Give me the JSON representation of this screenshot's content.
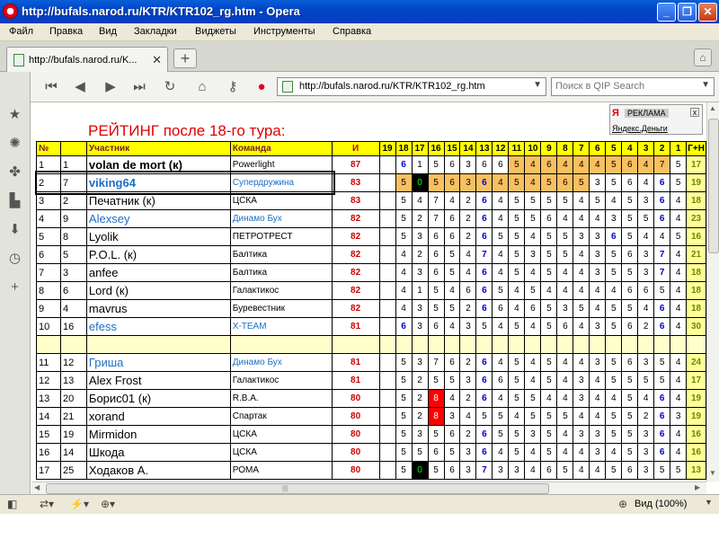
{
  "window": {
    "title": "http://bufals.narod.ru/KTR/KTR102_rg.htm - Opera"
  },
  "menu": [
    "Файл",
    "Правка",
    "Вид",
    "Закладки",
    "Виджеты",
    "Инструменты",
    "Справка"
  ],
  "tab": {
    "label": "http://bufals.narod.ru/K..."
  },
  "address": {
    "url": "http://bufals.narod.ru/KTR/KTR102_rg.htm"
  },
  "search": {
    "placeholder": "Поиск в QIP Search"
  },
  "ad": {
    "label": "РЕКЛАМА",
    "link": "Яндекс.Деньги"
  },
  "page": {
    "title": "РЕЙТИНГ после 18-го тура:",
    "headers": {
      "num": "№",
      "player": "Участник",
      "team": "Команда",
      "points": "И",
      "tours": [
        "19",
        "18",
        "17",
        "16",
        "15",
        "14",
        "13",
        "12",
        "11",
        "10",
        "9",
        "8",
        "7",
        "6",
        "5",
        "4",
        "3",
        "2",
        "1"
      ],
      "gp": "Г+Н"
    },
    "rows": [
      {
        "pos": "1",
        "id": "1",
        "name": "volan de mort (к)",
        "team": "Powerlight",
        "pts": "87",
        "gp": "17",
        "scores": [
          "",
          "6",
          "1",
          "5",
          "6",
          "3",
          "6",
          "6",
          "5",
          "4",
          "6",
          "4",
          "4",
          "4",
          "5",
          "6",
          "4",
          "7",
          "5"
        ]
      },
      {
        "pos": "2",
        "id": "7",
        "name": "viking64",
        "team": "Супердружина",
        "pts": "83",
        "gp": "19",
        "scores": [
          "",
          "5",
          "0",
          "5",
          "6",
          "3",
          "6",
          "4",
          "5",
          "4",
          "5",
          "6",
          "5",
          "3",
          "5",
          "6",
          "4",
          "6",
          "5"
        ]
      },
      {
        "pos": "3",
        "id": "2",
        "name": "Печатник (к)",
        "team": "ЦСКА",
        "pts": "83",
        "gp": "18",
        "scores": [
          "",
          "5",
          "4",
          "7",
          "4",
          "2",
          "6",
          "4",
          "5",
          "5",
          "5",
          "5",
          "4",
          "5",
          "4",
          "5",
          "3",
          "6",
          "4"
        ]
      },
      {
        "pos": "4",
        "id": "9",
        "name": "Alexsey",
        "team": "Динамо Бух",
        "pts": "82",
        "gp": "23",
        "scores": [
          "",
          "5",
          "2",
          "7",
          "6",
          "2",
          "6",
          "4",
          "5",
          "5",
          "6",
          "4",
          "4",
          "4",
          "3",
          "5",
          "5",
          "6",
          "4"
        ]
      },
      {
        "pos": "5",
        "id": "8",
        "name": "Lyolik",
        "team": "ПЕТРОТРЕСТ",
        "pts": "82",
        "gp": "16",
        "scores": [
          "",
          "5",
          "3",
          "6",
          "6",
          "2",
          "6",
          "5",
          "5",
          "4",
          "5",
          "5",
          "3",
          "3",
          "6",
          "5",
          "4",
          "4",
          "5"
        ]
      },
      {
        "pos": "6",
        "id": "5",
        "name": "P.O.L. (к)",
        "team": "Балтика",
        "pts": "82",
        "gp": "21",
        "scores": [
          "",
          "4",
          "2",
          "6",
          "5",
          "4",
          "7",
          "4",
          "5",
          "3",
          "5",
          "5",
          "4",
          "3",
          "5",
          "6",
          "3",
          "7",
          "4"
        ]
      },
      {
        "pos": "7",
        "id": "3",
        "name": "anfee",
        "team": "Балтика",
        "pts": "82",
        "gp": "18",
        "scores": [
          "",
          "4",
          "3",
          "6",
          "5",
          "4",
          "6",
          "4",
          "5",
          "4",
          "5",
          "4",
          "4",
          "3",
          "5",
          "5",
          "3",
          "7",
          "4"
        ]
      },
      {
        "pos": "8",
        "id": "6",
        "name": "Lord (к)",
        "team": "Галактикос",
        "pts": "82",
        "gp": "18",
        "scores": [
          "",
          "4",
          "1",
          "5",
          "4",
          "6",
          "6",
          "5",
          "4",
          "5",
          "4",
          "4",
          "4",
          "4",
          "4",
          "6",
          "6",
          "5",
          "4"
        ]
      },
      {
        "pos": "9",
        "id": "4",
        "name": "mavrus",
        "team": "Буревестник",
        "pts": "82",
        "gp": "18",
        "scores": [
          "",
          "4",
          "3",
          "5",
          "5",
          "2",
          "6",
          "6",
          "4",
          "6",
          "5",
          "3",
          "5",
          "4",
          "5",
          "5",
          "4",
          "6",
          "4"
        ]
      },
      {
        "pos": "10",
        "id": "16",
        "name": "efess",
        "team": "X-TEAM",
        "pts": "81",
        "gp": "30",
        "scores": [
          "",
          "6",
          "3",
          "6",
          "4",
          "3",
          "5",
          "4",
          "5",
          "4",
          "5",
          "6",
          "4",
          "3",
          "5",
          "6",
          "2",
          "6",
          "4"
        ]
      },
      {
        "pos": "11",
        "id": "12",
        "name": "Гриша",
        "team": "Динамо Бух",
        "pts": "81",
        "gp": "24",
        "scores": [
          "",
          "5",
          "3",
          "7",
          "6",
          "2",
          "6",
          "4",
          "5",
          "4",
          "5",
          "4",
          "4",
          "3",
          "5",
          "6",
          "3",
          "5",
          "4"
        ]
      },
      {
        "pos": "12",
        "id": "13",
        "name": "Alex Frost",
        "team": "Галактикос",
        "pts": "81",
        "gp": "17",
        "scores": [
          "",
          "5",
          "2",
          "5",
          "5",
          "3",
          "6",
          "6",
          "5",
          "4",
          "5",
          "4",
          "3",
          "4",
          "5",
          "5",
          "5",
          "5",
          "4"
        ]
      },
      {
        "pos": "13",
        "id": "20",
        "name": "Борис01 (к)",
        "team": "R.B.A.",
        "pts": "80",
        "gp": "19",
        "scores": [
          "",
          "5",
          "2",
          "8",
          "4",
          "2",
          "6",
          "4",
          "5",
          "5",
          "4",
          "4",
          "3",
          "4",
          "4",
          "5",
          "4",
          "6",
          "4"
        ]
      },
      {
        "pos": "14",
        "id": "21",
        "name": "xorand",
        "team": "Спартак",
        "pts": "80",
        "gp": "19",
        "scores": [
          "",
          "5",
          "2",
          "8",
          "3",
          "4",
          "5",
          "5",
          "4",
          "5",
          "5",
          "5",
          "4",
          "4",
          "5",
          "5",
          "2",
          "6",
          "3"
        ]
      },
      {
        "pos": "15",
        "id": "19",
        "name": "Mirmidon",
        "team": "ЦСКА",
        "pts": "80",
        "gp": "16",
        "scores": [
          "",
          "5",
          "3",
          "5",
          "6",
          "2",
          "6",
          "5",
          "5",
          "3",
          "5",
          "4",
          "3",
          "3",
          "5",
          "5",
          "3",
          "6",
          "4"
        ]
      },
      {
        "pos": "16",
        "id": "14",
        "name": "Шкода",
        "team": "ЦСКА",
        "pts": "80",
        "gp": "16",
        "scores": [
          "",
          "5",
          "5",
          "6",
          "5",
          "3",
          "6",
          "4",
          "5",
          "4",
          "5",
          "4",
          "4",
          "3",
          "4",
          "5",
          "3",
          "6",
          "4"
        ]
      },
      {
        "pos": "17",
        "id": "25",
        "name": "Ходаков А.",
        "team": "РОМА",
        "pts": "80",
        "gp": "13",
        "scores": [
          "",
          "5",
          "0",
          "5",
          "6",
          "3",
          "7",
          "3",
          "3",
          "4",
          "6",
          "5",
          "4",
          "4",
          "5",
          "6",
          "3",
          "5",
          "5"
        ]
      }
    ]
  },
  "status": {
    "zoom": "Вид (100%)"
  },
  "colors": {
    "title_red": "#e00000",
    "header_yellow": "#ffff00",
    "highlight_orange": "#f8c060"
  }
}
